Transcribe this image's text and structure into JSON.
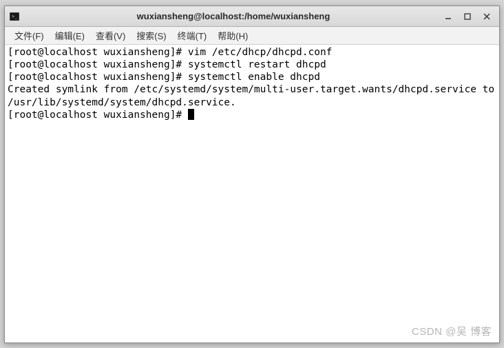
{
  "window": {
    "title": "wuxiansheng@localhost:/home/wuxiansheng"
  },
  "menubar": {
    "file": "文件(F)",
    "edit": "编辑(E)",
    "view": "查看(V)",
    "search": "搜索(S)",
    "terminal": "终端(T)",
    "help": "帮助(H)"
  },
  "terminal": {
    "lines": {
      "l0": "[root@localhost wuxiansheng]# vim /etc/dhcp/dhcpd.conf",
      "l1": "[root@localhost wuxiansheng]# systemctl restart dhcpd",
      "l2": "[root@localhost wuxiansheng]# systemctl enable dhcpd",
      "l3": "Created symlink from /etc/systemd/system/multi-user.target.wants/dhcpd.service to /usr/lib/systemd/system/dhcpd.service.",
      "l4": "[root@localhost wuxiansheng]# "
    }
  },
  "watermark": "CSDN @吴  博客"
}
